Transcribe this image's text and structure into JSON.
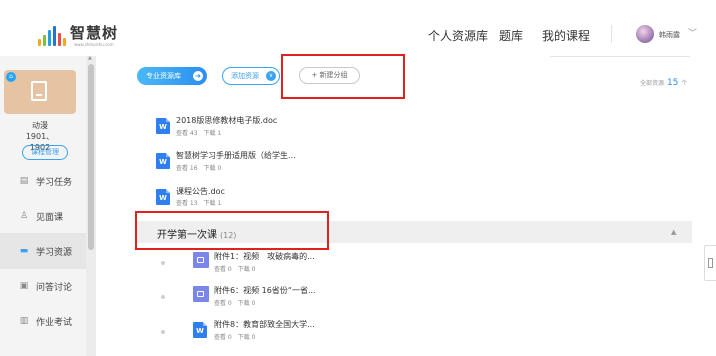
{
  "header": {
    "logo_text": "智慧树",
    "logo_sub": "www.zhihuishu.com",
    "nav": [
      "个人资源库",
      "题库",
      "我的课程"
    ],
    "user_name": "韩雨露"
  },
  "sidebar": {
    "course_name": "动漫1901、1902",
    "manage_label": "课程管理",
    "items": [
      {
        "label": "学习任务",
        "icon": "task-icon"
      },
      {
        "label": "见面课",
        "icon": "person-icon"
      },
      {
        "label": "学习资源",
        "icon": "resource-icon",
        "active": true
      },
      {
        "label": "问答讨论",
        "icon": "qa-icon"
      },
      {
        "label": "作业考试",
        "icon": "exam-icon"
      }
    ]
  },
  "toolbar": {
    "pro_library": "专业资源库",
    "add_resource": "添加资源",
    "new_group": "+ 新建分组",
    "total_label": "全部资源",
    "total_count": "15",
    "total_unit": "个"
  },
  "files": [
    {
      "title": "2018版思修教材电子版.doc",
      "views": "查看 43",
      "downloads": "下载 1",
      "type": "word"
    },
    {
      "title": "智慧树学习手册适用版（给学生...",
      "views": "查看 16",
      "downloads": "下载 0",
      "type": "word"
    },
    {
      "title": "课程公告.doc",
      "views": "查看 13",
      "downloads": "下载 1",
      "type": "word"
    }
  ],
  "section": {
    "title": "开学第一次课",
    "count": "(12)",
    "items": [
      {
        "title": "附件1：视频　攻破病毒的...",
        "views": "查看 0",
        "downloads": "下载 0",
        "type": "video"
      },
      {
        "title": "附件6：视频 16省份“一省...",
        "views": "查看 0",
        "downloads": "下载 0",
        "type": "video"
      },
      {
        "title": "附件8：教育部致全国大学...",
        "views": "查看 0",
        "downloads": "下载 0",
        "type": "word"
      }
    ]
  },
  "colors": {
    "accent": "#2b8ff0",
    "highlight": "#e0221f",
    "sidebar_bg": "#f4f4f4"
  }
}
